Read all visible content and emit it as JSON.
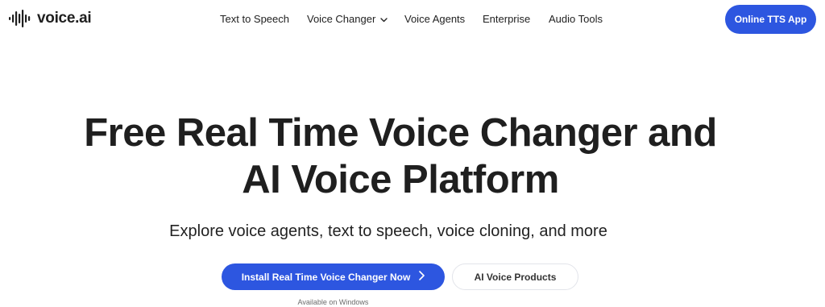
{
  "brand": {
    "name": "voice.ai",
    "logo_icon": "waveform-icon"
  },
  "nav": {
    "items": [
      {
        "label": "Text to Speech"
      },
      {
        "label": "Voice Changer",
        "icon": "chevron-down-icon"
      },
      {
        "label": "Voice Agents"
      },
      {
        "label": "Enterprise"
      },
      {
        "label": "Audio Tools"
      }
    ],
    "cta_label": "Online TTS App"
  },
  "hero": {
    "title_line1": "Free Real Time Voice Changer and",
    "title_line2": "AI Voice Platform",
    "subtitle": "Explore voice agents, text to speech, voice cloning, and more",
    "primary_button": {
      "label": "Install Real Time Voice Changer Now",
      "icon": "chevron-right-icon"
    },
    "secondary_button": {
      "label": "AI Voice Products"
    },
    "note": "Available on Windows"
  },
  "colors": {
    "accent": "#2d56e0",
    "text": "#1f1f1f",
    "background": "#ffffff"
  }
}
